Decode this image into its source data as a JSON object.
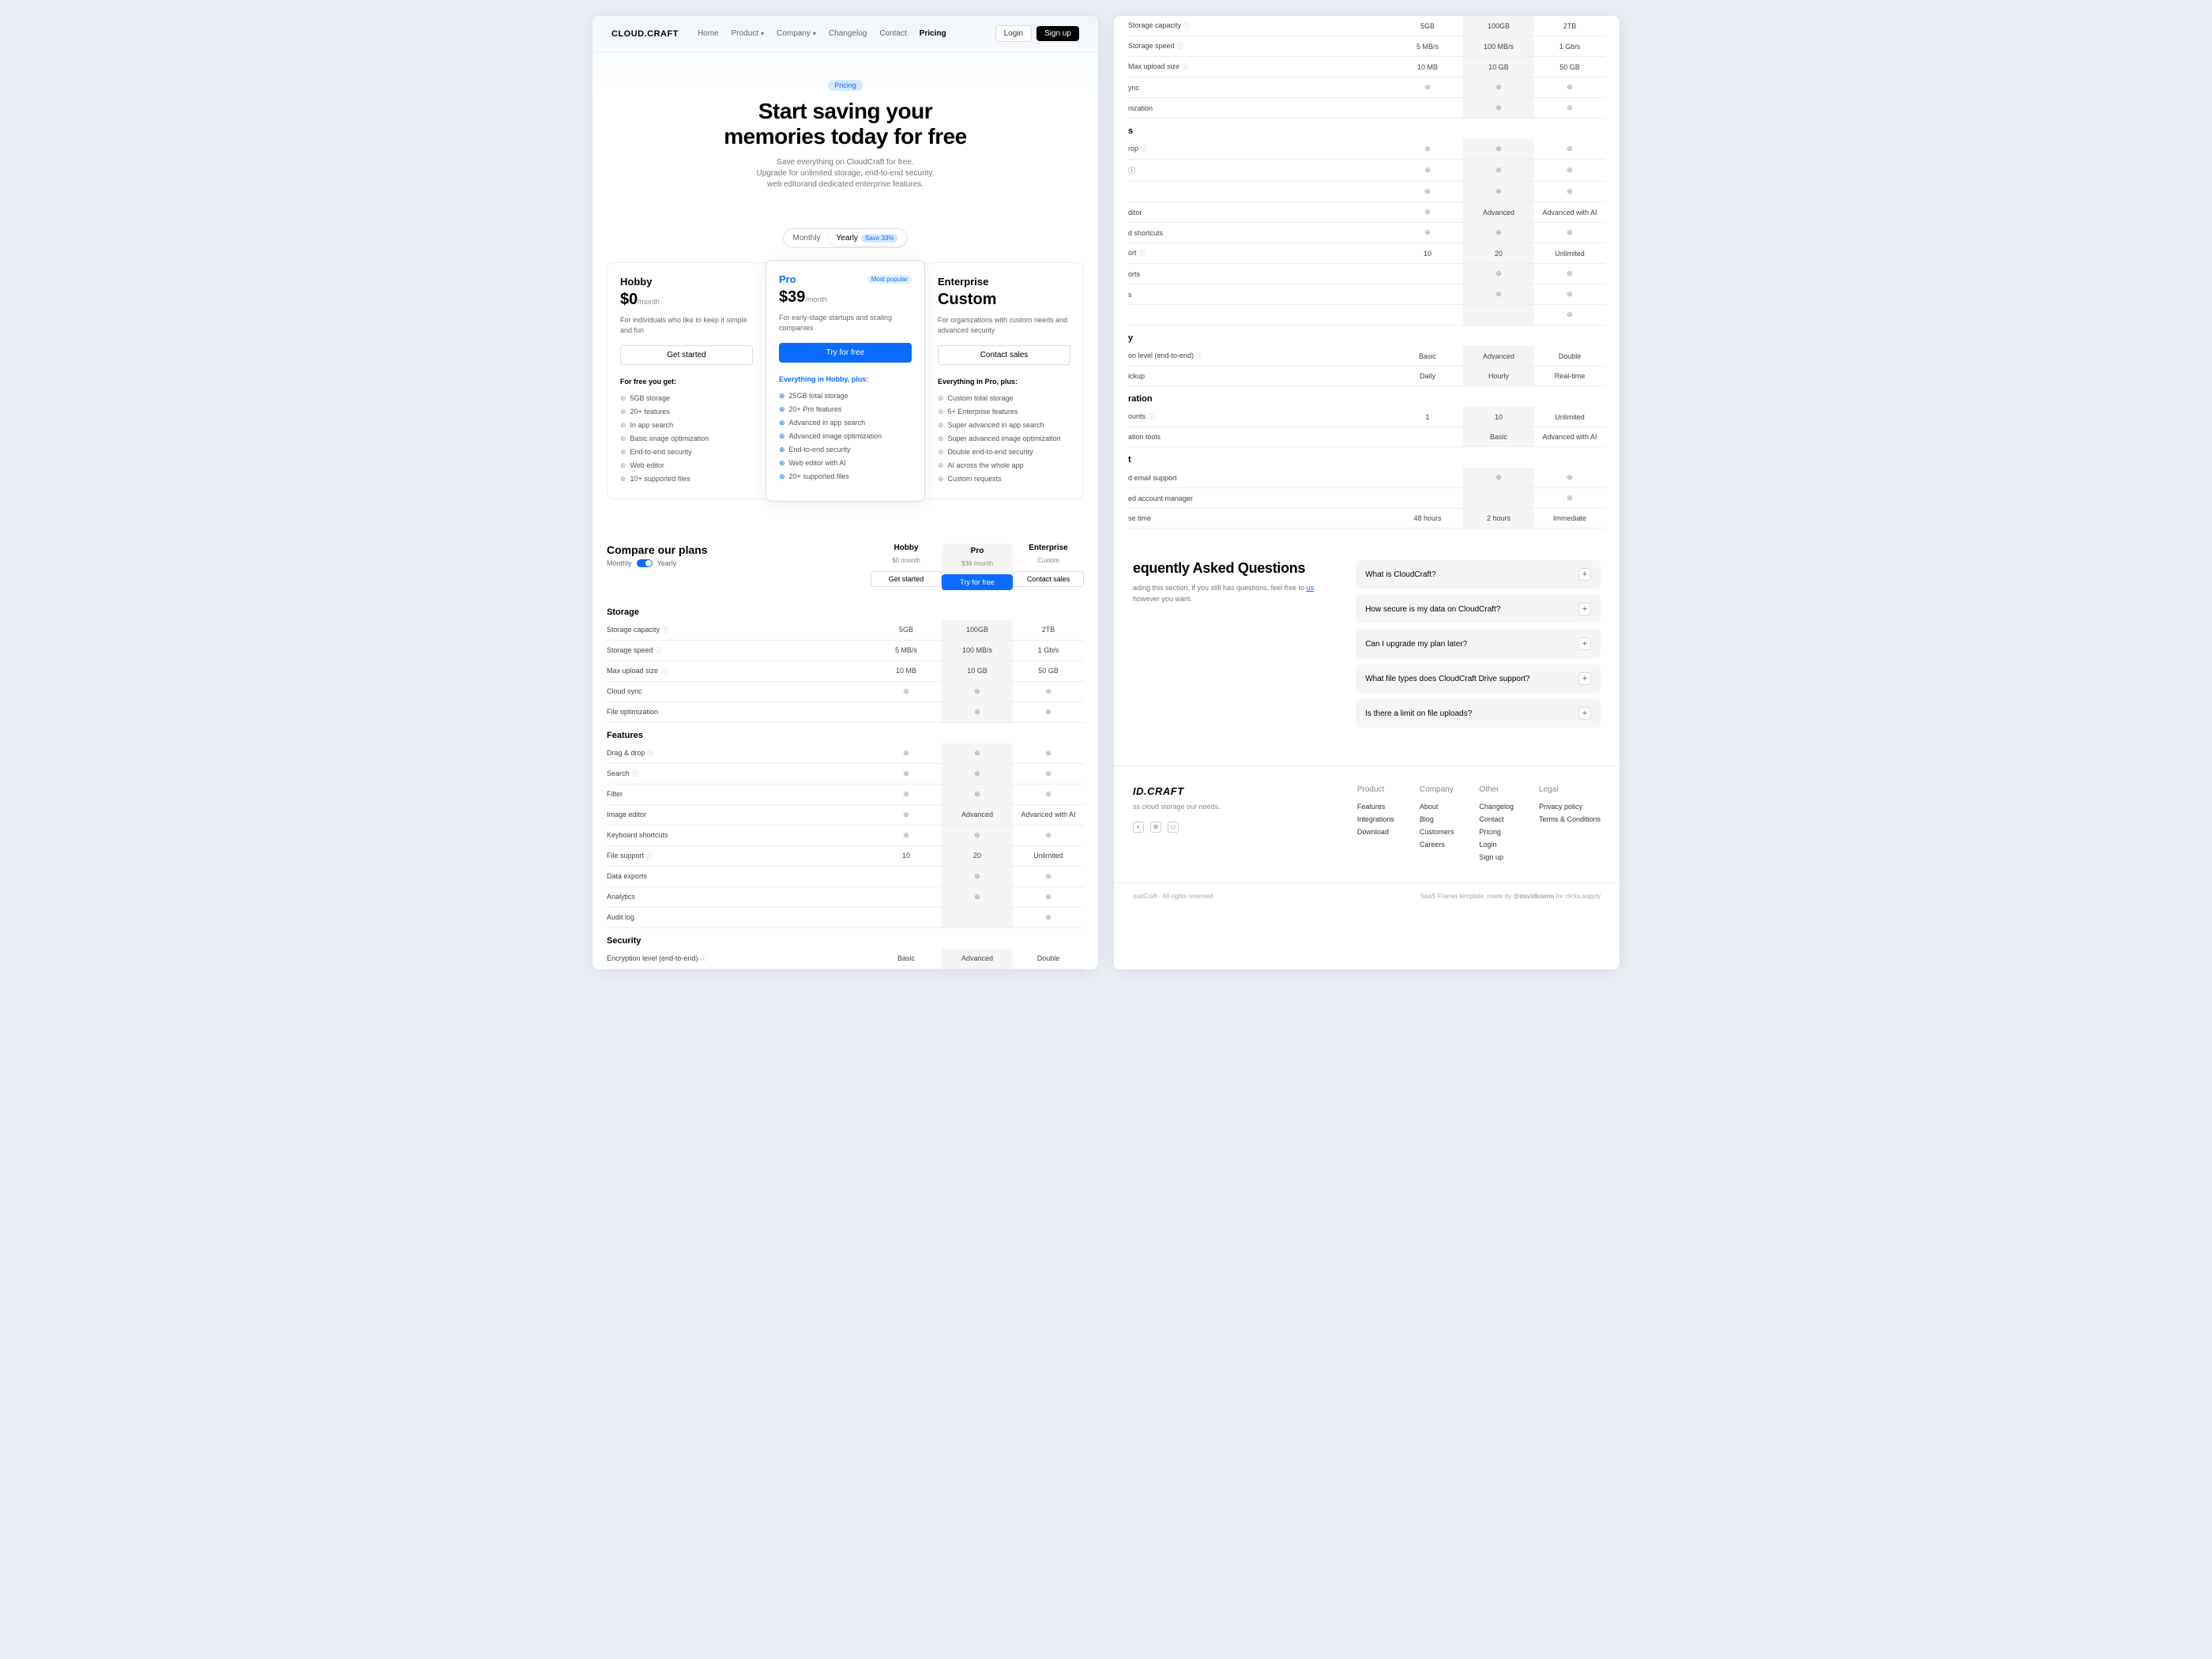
{
  "header": {
    "logo": "CLOUD.CRAFT",
    "nav": [
      "Home",
      "Product",
      "Company",
      "Changelog",
      "Contact",
      "Pricing"
    ],
    "login": "Login",
    "signup": "Sign up"
  },
  "hero": {
    "badge": "Pricing",
    "title_l1": "Start saving your",
    "title_l2": "memories today for free",
    "sub_l1": "Save everything on CloudCraft for free.",
    "sub_l2": "Upgrade for unlimited storage, end-to-end security,",
    "sub_l3": "web editorand dedicated enterprise features."
  },
  "toggle": {
    "monthly": "Monthly",
    "yearly": "Yearly",
    "save": "Save 33%"
  },
  "plans": [
    {
      "name": "Hobby",
      "price": "$0",
      "unit": "/month",
      "desc": "For individuals who like to keep it simple and fun",
      "cta": "Get started",
      "feat_h": "For free you get:",
      "feats": [
        "5GB storage",
        "20+ features",
        "In app search",
        "Basic image optimization",
        "End-to-end security",
        "Web editor",
        "10+ supported files"
      ]
    },
    {
      "name": "Pro",
      "price": "$39",
      "unit": "/month",
      "pop": "Most popular",
      "desc": "For early-stage startups and scaling companies",
      "cta": "Try for free",
      "feat_h": "Everything in Hobby, plus:",
      "feats": [
        "25GB total storage",
        "20+ Pro features",
        "Advanced in app search",
        "Advanced image optimization",
        "End-to-end security",
        "Web editor with AI",
        "20+ supported files"
      ]
    },
    {
      "name": "Enterprise",
      "price": "Custom",
      "unit": "",
      "desc": "For organizations with custom needs and advanced security",
      "cta": "Contact sales",
      "feat_h": "Everything in Pro, plus:",
      "feats": [
        "Custom total storage",
        "5+ Enterprise features",
        "Super advanced in app search",
        "Super advanced image optimization",
        "Double end-to-end security",
        "AI across the whole app",
        "Custom requests"
      ]
    }
  ],
  "compare": {
    "title": "Compare our plans",
    "monthly": "Monthly",
    "yearly": "Yearly",
    "cols": [
      {
        "name": "Hobby",
        "sub": "$0 /month",
        "cta": "Get started"
      },
      {
        "name": "Pro",
        "sub": "$39 /month",
        "cta": "Try for free"
      },
      {
        "name": "Enterprise",
        "sub": "Custom",
        "cta": "Contact sales"
      }
    ],
    "sections": [
      {
        "name": "Storage",
        "rows": [
          {
            "n": "Storage capacity",
            "i": true,
            "v": [
              "5GB",
              "100GB",
              "2TB"
            ]
          },
          {
            "n": "Storage speed",
            "i": true,
            "v": [
              "5 MB/s",
              "100 MB/s",
              "1 Gb/s"
            ]
          },
          {
            "n": "Max upload size",
            "i": true,
            "v": [
              "10 MB",
              "10 GB",
              "50 GB"
            ]
          },
          {
            "n": "Cloud sync",
            "v": [
              "✓",
              "✓",
              "✓"
            ]
          },
          {
            "n": "File optimization",
            "v": [
              "",
              "✓",
              "✓"
            ]
          }
        ]
      },
      {
        "name": "Features",
        "rows": [
          {
            "n": "Drag & drop",
            "i": true,
            "v": [
              "✓",
              "✓",
              "✓"
            ]
          },
          {
            "n": "Search",
            "i": true,
            "v": [
              "✓",
              "✓",
              "✓"
            ]
          },
          {
            "n": "Filter",
            "v": [
              "✓",
              "✓",
              "✓"
            ]
          },
          {
            "n": "Image editor",
            "v": [
              "✓",
              "Advanced",
              "Advanced with AI"
            ]
          },
          {
            "n": "Keyboard shortcuts",
            "v": [
              "✓",
              "✓",
              "✓"
            ]
          },
          {
            "n": "File support",
            "i": true,
            "v": [
              "10",
              "20",
              "Unlimited"
            ]
          },
          {
            "n": "Data exports",
            "v": [
              "",
              "✓",
              "✓"
            ]
          },
          {
            "n": "Analytics",
            "v": [
              "",
              "✓",
              "✓"
            ]
          },
          {
            "n": "Audit log",
            "v": [
              "",
              "",
              "✓"
            ]
          }
        ]
      },
      {
        "name": "Security",
        "rows": [
          {
            "n": "Encryption level (end-to-end)",
            "i": true,
            "v": [
              "Basic",
              "Advanced",
              "Double"
            ]
          }
        ]
      }
    ]
  },
  "right_table": {
    "sections": [
      {
        "name": "",
        "rows": [
          {
            "n": "Storage capacity",
            "i": true,
            "v": [
              "5GB",
              "100GB",
              "2TB"
            ]
          },
          {
            "n": "Storage speed",
            "i": true,
            "v": [
              "5 MB/s",
              "100 MB/s",
              "1 Gb/s"
            ]
          },
          {
            "n": "Max upload size",
            "i": true,
            "v": [
              "10 MB",
              "10 GB",
              "50 GB"
            ]
          },
          {
            "n": "ync",
            "v": [
              "✓",
              "✓",
              "✓"
            ]
          },
          {
            "n": "nization",
            "v": [
              "",
              "✓",
              "✓"
            ]
          }
        ]
      },
      {
        "name": "s",
        "rows": [
          {
            "n": "rop",
            "i": true,
            "v": [
              "✓",
              "✓",
              "✓"
            ]
          },
          {
            "n": "ⓘ",
            "v": [
              "✓",
              "✓",
              "✓"
            ]
          },
          {
            "n": "",
            "v": [
              "✓",
              "✓",
              "✓"
            ]
          },
          {
            "n": "ditor",
            "v": [
              "✓",
              "Advanced",
              "Advanced with AI"
            ]
          },
          {
            "n": "d shortcuts",
            "v": [
              "✓",
              "✓",
              "✓"
            ]
          },
          {
            "n": "ort",
            "i": true,
            "v": [
              "10",
              "20",
              "Unlimited"
            ]
          },
          {
            "n": "orts",
            "v": [
              "",
              "✓",
              "✓"
            ]
          },
          {
            "n": "s",
            "v": [
              "",
              "✓",
              "✓"
            ]
          },
          {
            "n": "",
            "v": [
              "",
              "",
              "✓"
            ]
          }
        ]
      },
      {
        "name": "y",
        "rows": [
          {
            "n": "on level (end-to-end)",
            "i": true,
            "v": [
              "Basic",
              "Advanced",
              "Double"
            ]
          },
          {
            "n": "ickup",
            "v": [
              "Daily",
              "Hourly",
              "Real-time"
            ]
          }
        ]
      },
      {
        "name": "ration",
        "rows": [
          {
            "n": "ounts",
            "i": true,
            "v": [
              "1",
              "10",
              "Unlimited"
            ]
          },
          {
            "n": "ation tools",
            "v": [
              "",
              "Basic",
              "Advanced with AI"
            ]
          }
        ]
      },
      {
        "name": "t",
        "rows": [
          {
            "n": "d email support",
            "v": [
              "",
              "✓",
              "✓"
            ]
          },
          {
            "n": "ed account manager",
            "v": [
              "",
              "",
              "✓"
            ]
          },
          {
            "n": "se time",
            "v": [
              "48 hours",
              "2 hours",
              "Immediate"
            ]
          }
        ]
      }
    ]
  },
  "faq": {
    "title": "equently Asked Questions",
    "sub": "ading this section, if you still has questions, feel free to ",
    "link": "us",
    "sub2": " however you want.",
    "items": [
      "What is CloudCraft?",
      "How secure is my data on CloudCraft?",
      "Can I upgrade my plan later?",
      "What file types does CloudCraft Drive support?",
      "Is there a limit on file uploads?"
    ]
  },
  "footer": {
    "logo": "ID.CRAFT",
    "tagline": "ss cloud storage\nour needs.",
    "cols": [
      {
        "h": "Product",
        "links": [
          "Features",
          "Integrations",
          "Download"
        ]
      },
      {
        "h": "Company",
        "links": [
          "About",
          "Blog",
          "Customers",
          "Careers"
        ]
      },
      {
        "h": "Other",
        "links": [
          "Changelog",
          "Contact",
          "Pricing",
          "Login",
          "Sign up"
        ]
      },
      {
        "h": "Legal",
        "links": [
          "Privacy policy",
          "Terms & Conditions"
        ]
      }
    ],
    "copy": "oudCraft - All rights reserved",
    "credit_pre": "SaaS Framer template, made by ",
    "credit_link": "@davidkaimn",
    "credit_post": " for clicks.supply"
  }
}
